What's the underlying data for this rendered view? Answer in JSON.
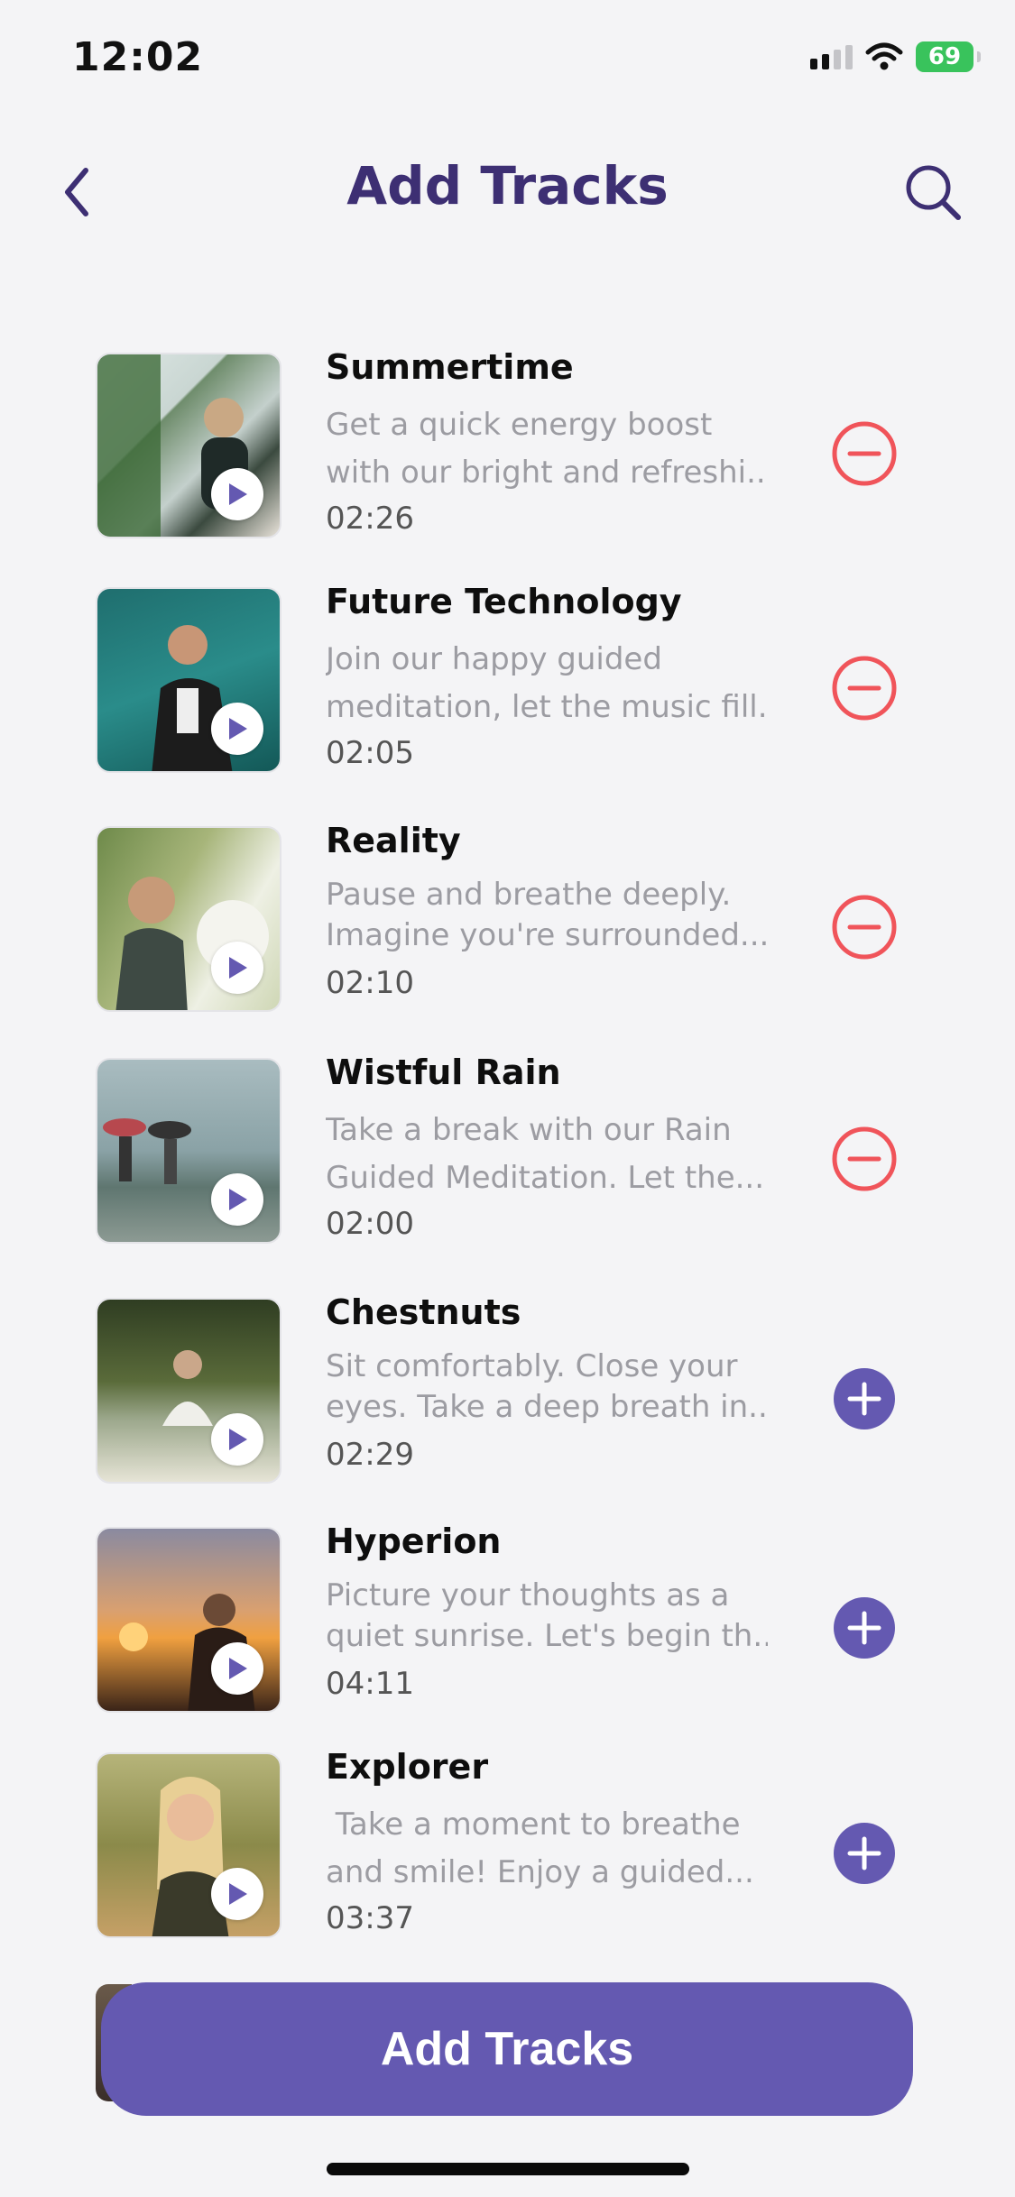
{
  "status_bar": {
    "time": "12:02",
    "battery": "69"
  },
  "header": {
    "title": "Add Tracks"
  },
  "colors": {
    "accent": "#6459b1",
    "title": "#3d2f73",
    "remove": "#f0545a",
    "add": "#6459b1",
    "battery": "#39c35c"
  },
  "tracks": [
    {
      "title": "Summertime",
      "desc_line1": "Get a quick energy boost",
      "desc_line2": "with our bright and refreshi...",
      "duration": "02:26",
      "action": "remove",
      "image": "woman-headphones-plants"
    },
    {
      "title": "Future Technology",
      "desc_line1": "Join our happy guided",
      "desc_line2": "meditation, let the music fill...",
      "duration": "02:05",
      "action": "remove",
      "image": "woman-dancing-headphones"
    },
    {
      "title": "Reality",
      "desc_line1": "Pause and breathe deeply.",
      "desc_line2": "Imagine you're surrounded...",
      "duration": "02:10",
      "action": "remove",
      "image": "woman-smelling-flowers"
    },
    {
      "title": "Wistful Rain",
      "desc_line1": "Take a break with our Rain",
      "desc_line2": "Guided Meditation. Let the...",
      "duration": "02:00",
      "action": "remove",
      "image": "rainy-window-umbrellas"
    },
    {
      "title": "Chestnuts",
      "desc_line1": "Sit comfortably. Close your",
      "desc_line2": "eyes. Take a deep breath in...",
      "duration": "02:29",
      "action": "add",
      "image": "meditating-in-forest"
    },
    {
      "title": "Hyperion",
      "desc_line1": "Picture your thoughts as a",
      "desc_line2": "quiet sunrise. Let's begin th...",
      "duration": "04:11",
      "action": "add",
      "image": "woman-sunset"
    },
    {
      "title": "Explorer",
      "desc_line1": " Take a moment to breathe",
      "desc_line2": "and smile! Enjoy a guided...",
      "duration": "03:37",
      "action": "add",
      "image": "smiling-woman-outdoors"
    }
  ],
  "footer": {
    "button_label": "Add Tracks"
  }
}
